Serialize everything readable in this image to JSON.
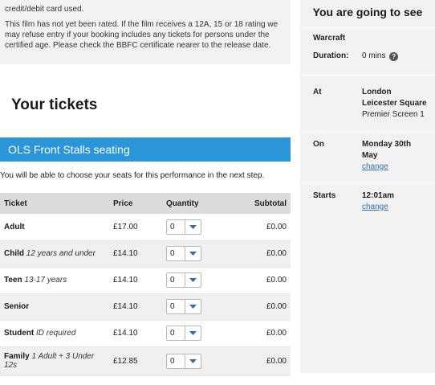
{
  "notice": {
    "line1": "credit/debit card used.",
    "line2": "This film has not yet been rated. If the film receives a 12A, 15 or 18 rating we may refuse entry if your booking includes any tickets for persons under the certified age. Please check the BBFC certificate nearer to the release date."
  },
  "tickets": {
    "heading": "Your tickets",
    "seating": "OLS Front Stalls seating",
    "choose_note": "You will be able to choose your seats for this performance in the next step.",
    "columns": {
      "ticket": "Ticket",
      "price": "Price",
      "quantity": "Quantity",
      "subtotal": "Subtotal"
    },
    "rows": [
      {
        "name": "Adult",
        "detail": "",
        "price": "£17.00",
        "qty": "0",
        "subtotal": "£0.00"
      },
      {
        "name": "Child",
        "detail": "12 years and under",
        "price": "£14.10",
        "qty": "0",
        "subtotal": "£0.00"
      },
      {
        "name": "Teen",
        "detail": "13-17 years",
        "price": "£14.10",
        "qty": "0",
        "subtotal": "£0.00"
      },
      {
        "name": "Senior",
        "detail": "",
        "price": "£14.10",
        "qty": "0",
        "subtotal": "£0.00"
      },
      {
        "name": "Student",
        "detail": "ID required",
        "price": "£14.10",
        "qty": "0",
        "subtotal": "£0.00"
      },
      {
        "name": "Family",
        "detail": "1 Adult + 3 Under 12s",
        "price": "£12.85",
        "qty": "0",
        "subtotal": "£0.00"
      }
    ]
  },
  "summary": {
    "title": "You are going to see",
    "film": "Warcraft",
    "duration_label": "Duration:",
    "duration_value": "0 mins",
    "help_icon": "question-circle-icon",
    "at_label": "At",
    "cinema_line1": "London",
    "cinema_line2": "Leicester Square",
    "screen": "Premier Screen 1",
    "on_label": "On",
    "date_line1": "Monday 30th",
    "date_line2": "May",
    "date_change": "change",
    "starts_label": "Starts",
    "time": "12:01am",
    "time_change": "change"
  },
  "colors": {
    "accent": "#2a95d8",
    "link": "#2a6fb0",
    "panel": "#f2f2f2"
  }
}
